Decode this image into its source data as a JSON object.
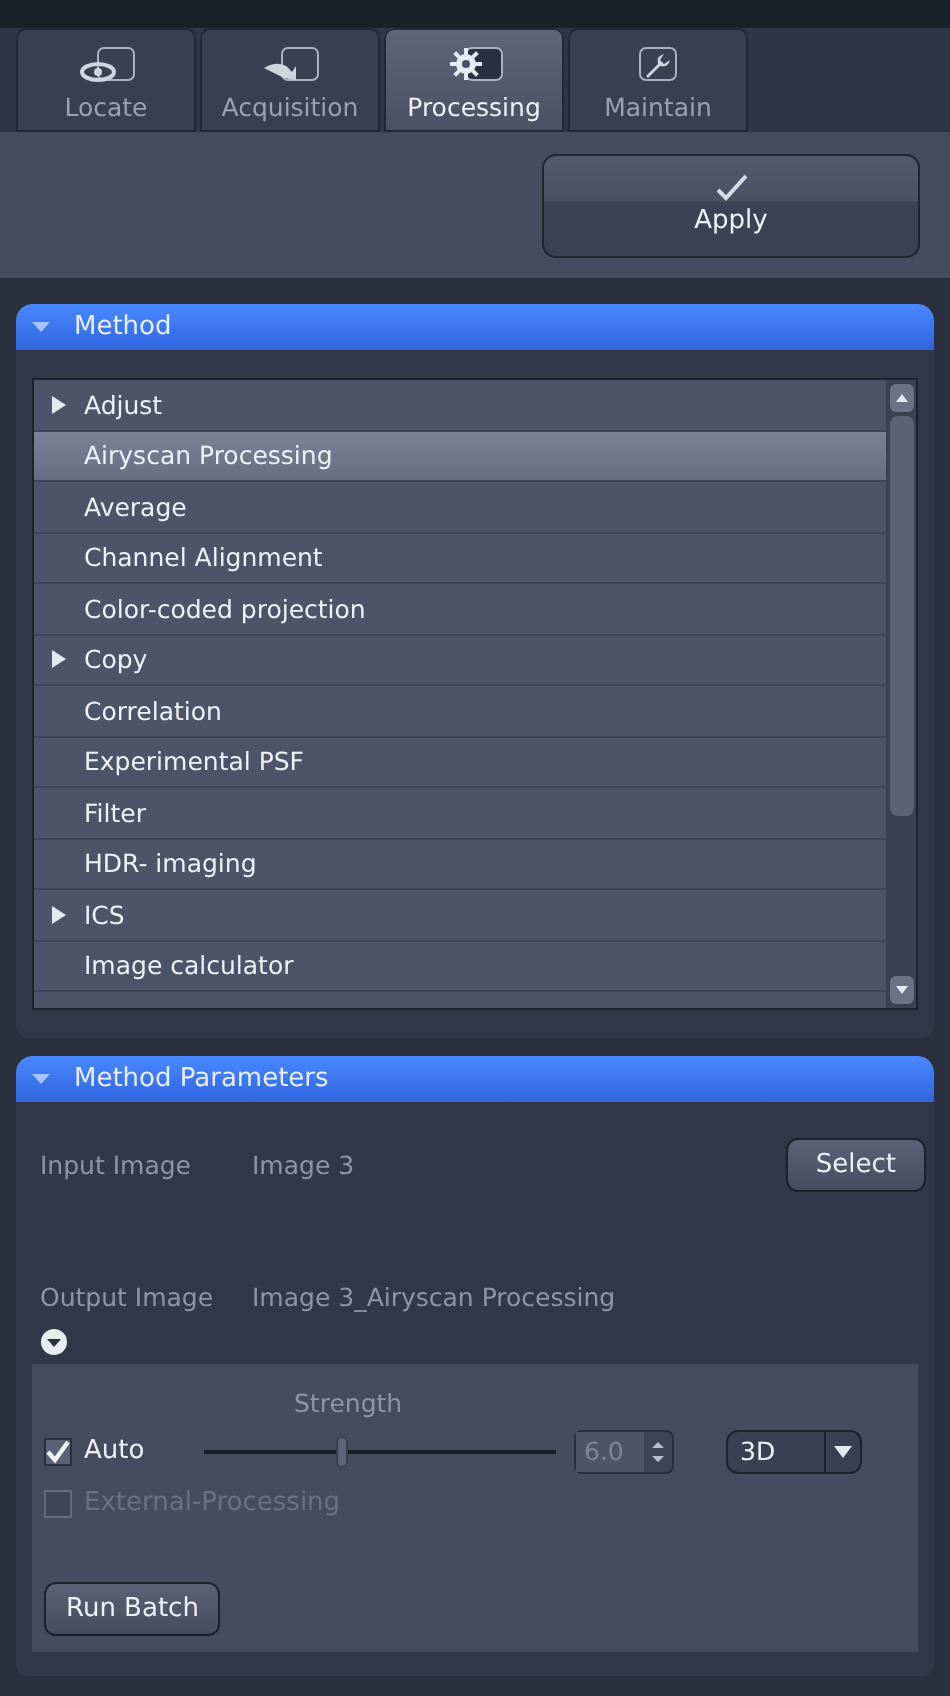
{
  "tabs": [
    {
      "label": "Locate",
      "selected": false
    },
    {
      "label": "Acquisition",
      "selected": false
    },
    {
      "label": "Processing",
      "selected": true
    },
    {
      "label": "Maintain",
      "selected": false
    }
  ],
  "apply_button": {
    "label": "Apply"
  },
  "method": {
    "title": "Method",
    "expanded": true,
    "items": [
      {
        "label": "Adjust",
        "has_children": true,
        "selected": false
      },
      {
        "label": "Airyscan Processing",
        "has_children": false,
        "selected": true
      },
      {
        "label": "Average",
        "has_children": false,
        "selected": false
      },
      {
        "label": "Channel Alignment",
        "has_children": false,
        "selected": false
      },
      {
        "label": "Color-coded projection",
        "has_children": false,
        "selected": false
      },
      {
        "label": "Copy",
        "has_children": true,
        "selected": false
      },
      {
        "label": "Correlation",
        "has_children": false,
        "selected": false
      },
      {
        "label": "Experimental PSF",
        "has_children": false,
        "selected": false
      },
      {
        "label": "Filter",
        "has_children": false,
        "selected": false
      },
      {
        "label": "HDR- imaging",
        "has_children": false,
        "selected": false
      },
      {
        "label": "ICS",
        "has_children": true,
        "selected": false
      },
      {
        "label": "Image calculator",
        "has_children": false,
        "selected": false
      }
    ]
  },
  "parameters": {
    "title": "Method Parameters",
    "expanded": true,
    "input_label": "Input Image",
    "input_value": "Image 3",
    "select_button": "Select",
    "output_label": "Output Image",
    "output_value": "Image 3_Airyscan Processing",
    "strength_label": "Strength",
    "auto": {
      "label": "Auto",
      "checked": true
    },
    "strength": {
      "level": 0.39,
      "value": "6.0",
      "disabled": true
    },
    "mode": {
      "value": "3D"
    },
    "external": {
      "label": "External-Processing",
      "checked": false,
      "disabled": true
    },
    "run_batch": "Run Batch"
  }
}
